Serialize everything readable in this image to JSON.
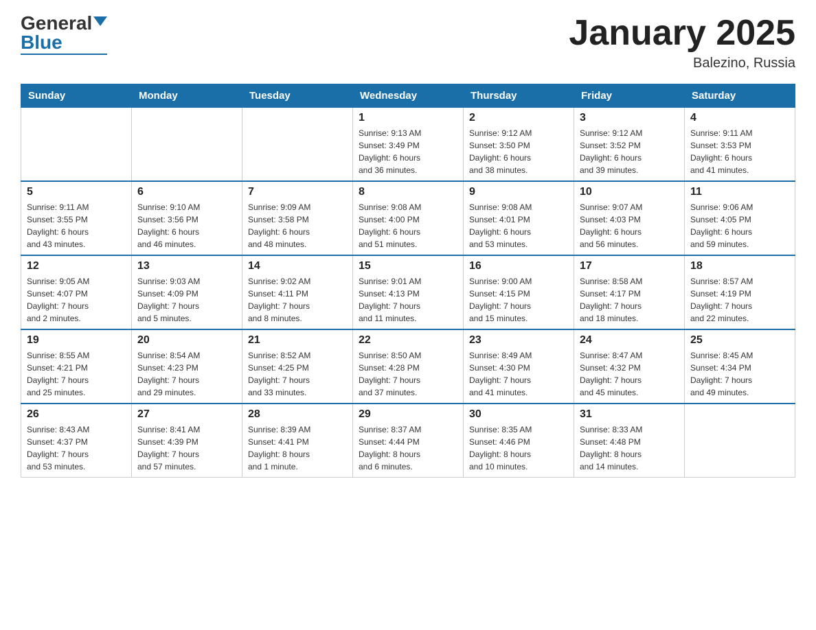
{
  "header": {
    "logo_general": "General",
    "logo_blue": "Blue",
    "title": "January 2025",
    "subtitle": "Balezino, Russia"
  },
  "days_of_week": [
    "Sunday",
    "Monday",
    "Tuesday",
    "Wednesday",
    "Thursday",
    "Friday",
    "Saturday"
  ],
  "weeks": [
    [
      {
        "num": "",
        "info": ""
      },
      {
        "num": "",
        "info": ""
      },
      {
        "num": "",
        "info": ""
      },
      {
        "num": "1",
        "info": "Sunrise: 9:13 AM\nSunset: 3:49 PM\nDaylight: 6 hours\nand 36 minutes."
      },
      {
        "num": "2",
        "info": "Sunrise: 9:12 AM\nSunset: 3:50 PM\nDaylight: 6 hours\nand 38 minutes."
      },
      {
        "num": "3",
        "info": "Sunrise: 9:12 AM\nSunset: 3:52 PM\nDaylight: 6 hours\nand 39 minutes."
      },
      {
        "num": "4",
        "info": "Sunrise: 9:11 AM\nSunset: 3:53 PM\nDaylight: 6 hours\nand 41 minutes."
      }
    ],
    [
      {
        "num": "5",
        "info": "Sunrise: 9:11 AM\nSunset: 3:55 PM\nDaylight: 6 hours\nand 43 minutes."
      },
      {
        "num": "6",
        "info": "Sunrise: 9:10 AM\nSunset: 3:56 PM\nDaylight: 6 hours\nand 46 minutes."
      },
      {
        "num": "7",
        "info": "Sunrise: 9:09 AM\nSunset: 3:58 PM\nDaylight: 6 hours\nand 48 minutes."
      },
      {
        "num": "8",
        "info": "Sunrise: 9:08 AM\nSunset: 4:00 PM\nDaylight: 6 hours\nand 51 minutes."
      },
      {
        "num": "9",
        "info": "Sunrise: 9:08 AM\nSunset: 4:01 PM\nDaylight: 6 hours\nand 53 minutes."
      },
      {
        "num": "10",
        "info": "Sunrise: 9:07 AM\nSunset: 4:03 PM\nDaylight: 6 hours\nand 56 minutes."
      },
      {
        "num": "11",
        "info": "Sunrise: 9:06 AM\nSunset: 4:05 PM\nDaylight: 6 hours\nand 59 minutes."
      }
    ],
    [
      {
        "num": "12",
        "info": "Sunrise: 9:05 AM\nSunset: 4:07 PM\nDaylight: 7 hours\nand 2 minutes."
      },
      {
        "num": "13",
        "info": "Sunrise: 9:03 AM\nSunset: 4:09 PM\nDaylight: 7 hours\nand 5 minutes."
      },
      {
        "num": "14",
        "info": "Sunrise: 9:02 AM\nSunset: 4:11 PM\nDaylight: 7 hours\nand 8 minutes."
      },
      {
        "num": "15",
        "info": "Sunrise: 9:01 AM\nSunset: 4:13 PM\nDaylight: 7 hours\nand 11 minutes."
      },
      {
        "num": "16",
        "info": "Sunrise: 9:00 AM\nSunset: 4:15 PM\nDaylight: 7 hours\nand 15 minutes."
      },
      {
        "num": "17",
        "info": "Sunrise: 8:58 AM\nSunset: 4:17 PM\nDaylight: 7 hours\nand 18 minutes."
      },
      {
        "num": "18",
        "info": "Sunrise: 8:57 AM\nSunset: 4:19 PM\nDaylight: 7 hours\nand 22 minutes."
      }
    ],
    [
      {
        "num": "19",
        "info": "Sunrise: 8:55 AM\nSunset: 4:21 PM\nDaylight: 7 hours\nand 25 minutes."
      },
      {
        "num": "20",
        "info": "Sunrise: 8:54 AM\nSunset: 4:23 PM\nDaylight: 7 hours\nand 29 minutes."
      },
      {
        "num": "21",
        "info": "Sunrise: 8:52 AM\nSunset: 4:25 PM\nDaylight: 7 hours\nand 33 minutes."
      },
      {
        "num": "22",
        "info": "Sunrise: 8:50 AM\nSunset: 4:28 PM\nDaylight: 7 hours\nand 37 minutes."
      },
      {
        "num": "23",
        "info": "Sunrise: 8:49 AM\nSunset: 4:30 PM\nDaylight: 7 hours\nand 41 minutes."
      },
      {
        "num": "24",
        "info": "Sunrise: 8:47 AM\nSunset: 4:32 PM\nDaylight: 7 hours\nand 45 minutes."
      },
      {
        "num": "25",
        "info": "Sunrise: 8:45 AM\nSunset: 4:34 PM\nDaylight: 7 hours\nand 49 minutes."
      }
    ],
    [
      {
        "num": "26",
        "info": "Sunrise: 8:43 AM\nSunset: 4:37 PM\nDaylight: 7 hours\nand 53 minutes."
      },
      {
        "num": "27",
        "info": "Sunrise: 8:41 AM\nSunset: 4:39 PM\nDaylight: 7 hours\nand 57 minutes."
      },
      {
        "num": "28",
        "info": "Sunrise: 8:39 AM\nSunset: 4:41 PM\nDaylight: 8 hours\nand 1 minute."
      },
      {
        "num": "29",
        "info": "Sunrise: 8:37 AM\nSunset: 4:44 PM\nDaylight: 8 hours\nand 6 minutes."
      },
      {
        "num": "30",
        "info": "Sunrise: 8:35 AM\nSunset: 4:46 PM\nDaylight: 8 hours\nand 10 minutes."
      },
      {
        "num": "31",
        "info": "Sunrise: 8:33 AM\nSunset: 4:48 PM\nDaylight: 8 hours\nand 14 minutes."
      },
      {
        "num": "",
        "info": ""
      }
    ]
  ]
}
